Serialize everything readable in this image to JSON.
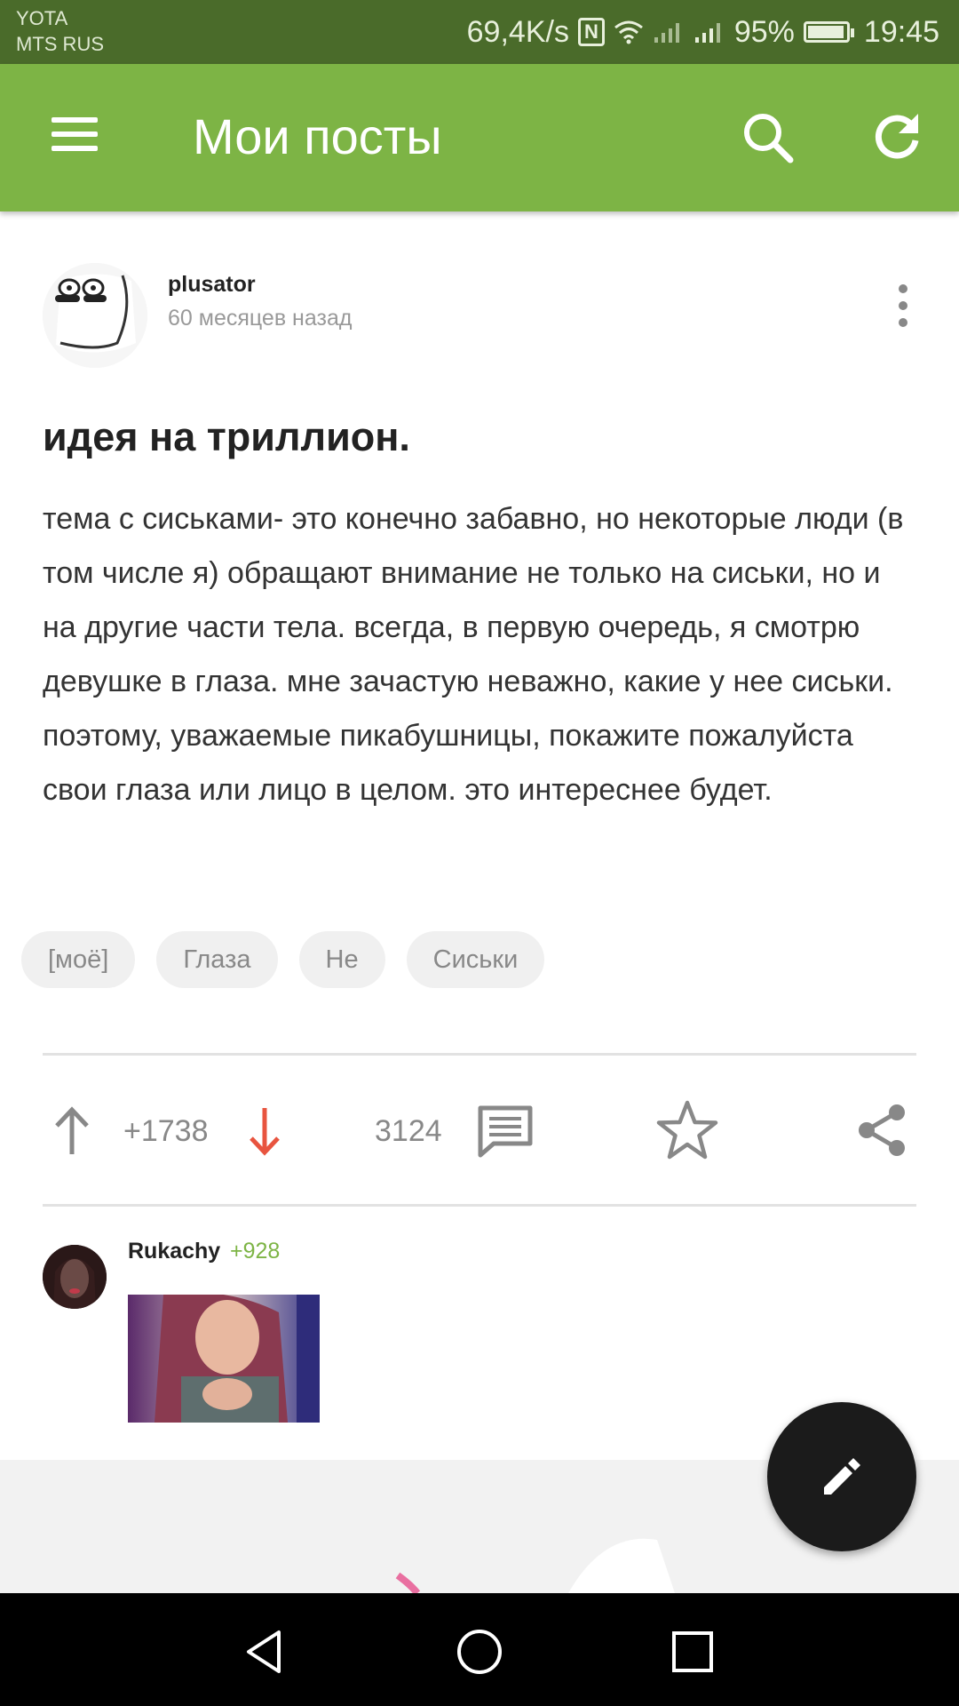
{
  "status_bar": {
    "carrier_1": "YOTA",
    "carrier_2": "MTS RUS",
    "speed": "69,4K/s",
    "nfc": "N",
    "battery": "95%",
    "battery_level": 0.95,
    "time": "19:45"
  },
  "app_bar": {
    "title": "Мои посты",
    "icons": [
      "menu-icon",
      "search-icon",
      "refresh-icon"
    ]
  },
  "post": {
    "author": "plusator",
    "time": "60 месяцев назад",
    "title": "идея на триллион.",
    "body": "тема с сиськами- это конечно забавно, но некоторые люди (в том числе я) обращают внимание не только на сиськи, но и на другие части тела. всегда, в первую очередь, я смотрю девушке в глаза. мне зачастую неважно, какие у нее сиськи. поэтому, уважаемые пикабушницы, покажите пожалуйста свои глаза или лицо в целом. это интереснее будет.",
    "tags": [
      "[моё]",
      "Глаза",
      "Не",
      "Сиськи"
    ],
    "rating": "+1738",
    "comments_count": "3124"
  },
  "comment": {
    "author": "Rukachy",
    "score": "+928"
  },
  "colors": {
    "app_bar": "#7db445",
    "status_bar": "#4a6b2a",
    "downvote": "#e8543f",
    "accent_green": "#7db445"
  }
}
